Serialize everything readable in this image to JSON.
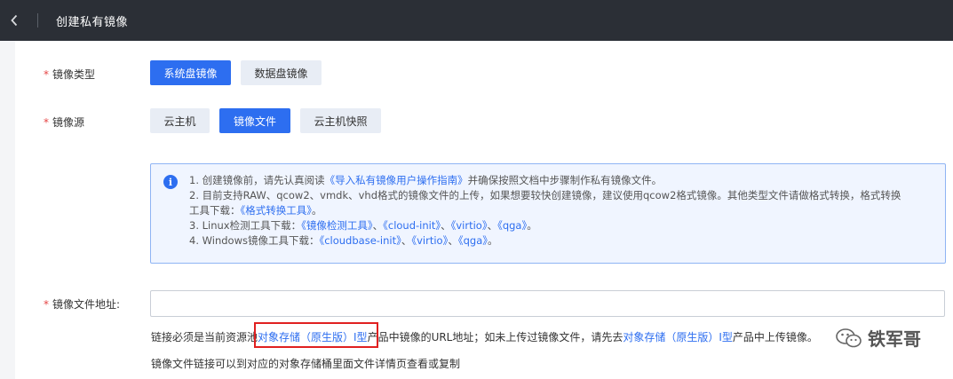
{
  "header": {
    "title": "创建私有镜像"
  },
  "form": {
    "image_type": {
      "label": "镜像类型",
      "options": [
        "系统盘镜像",
        "数据盘镜像"
      ],
      "selected": "系统盘镜像"
    },
    "image_source": {
      "label": "镜像源",
      "options": [
        "云主机",
        "镜像文件",
        "云主机快照"
      ],
      "selected": "镜像文件"
    },
    "info": {
      "line1_prefix": "1. 创建镜像前，请先认真阅读",
      "line1_link": "《导入私有镜像用户操作指南》",
      "line1_suffix": "并确保按照文档中步骤制作私有镜像文件。",
      "line2_text": "2. 目前支持RAW、qcow2、vmdk、vhd格式的镜像文件的上传，如果想要较快创建镜像，建议使用qcow2格式镜像。其他类型文件请做格式转换，格式转换",
      "line2b_prefix": "工具下载：",
      "line2b_link": "《格式转换工具》",
      "line2b_suffix": "。",
      "line3_prefix": "3. Linux检测工具下载：",
      "line3_link1": "《镜像检测工具》",
      "line3_link2": "《cloud-init》",
      "line3_link3": "《virtio》",
      "line3_link4": "《qga》",
      "line4_prefix": "4. Windows镜像工具下载：",
      "line4_link1": "《cloudbase-init》",
      "line4_link2": "《virtio》",
      "line4_link3": "《qga》",
      "sep": "、",
      "end": "。"
    },
    "file_url": {
      "label": "镜像文件地址:",
      "value": "",
      "hint1_prefix": "链接必须是当前资源池",
      "hint1_link1": "对象存储（原生版）Ⅰ型",
      "hint1_mid": "产品中镜像的URL地址；如未上传过镜像文件，请先去",
      "hint1_link2": "对象存储（原生版）Ⅰ型",
      "hint1_suffix": "产品中上传镜像。",
      "hint2": "镜像文件链接可以到对应的对象存储桶里面文件详情页查看或复制"
    }
  },
  "watermark": {
    "text": "铁军哥",
    "icon": "wechat-icon"
  },
  "required_mark": "*",
  "info_icon_glyph": "i",
  "colors": {
    "topbar": "#2b2f36",
    "accent": "#2d6ef0",
    "required": "#e54545",
    "highlight_box": "#e02020"
  }
}
